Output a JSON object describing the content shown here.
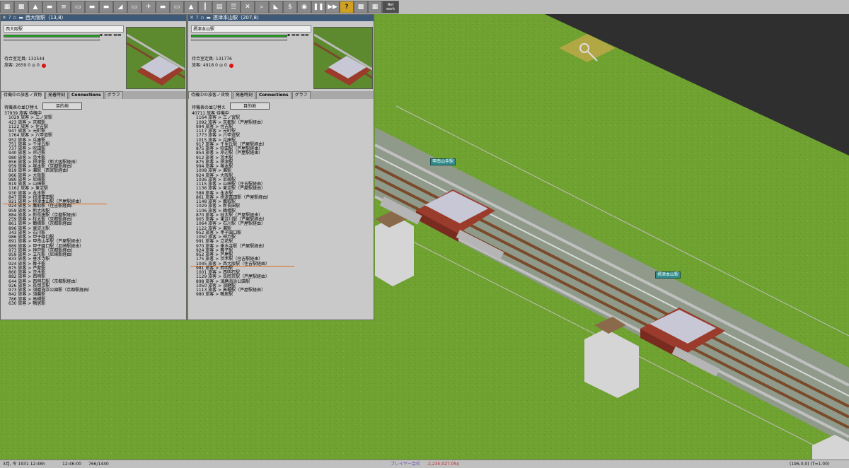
{
  "toolbar": {
    "buttons": [
      {
        "name": "save-icon",
        "glyph": "▦"
      },
      {
        "name": "map-icon",
        "glyph": "▩"
      },
      {
        "name": "landscape-icon",
        "glyph": "▲"
      },
      {
        "name": "road-icon",
        "glyph": "▬"
      },
      {
        "name": "rail-icon",
        "glyph": "≡"
      },
      {
        "name": "tram-icon",
        "glyph": "▭"
      },
      {
        "name": "monorail-icon",
        "glyph": "▬"
      },
      {
        "name": "maglev-icon",
        "glyph": "▬"
      },
      {
        "name": "ship-icon",
        "glyph": "◢"
      },
      {
        "name": "train-icon",
        "glyph": "▭"
      },
      {
        "name": "airport-icon",
        "glyph": "✈"
      },
      {
        "name": "bus-icon",
        "glyph": "▬"
      },
      {
        "name": "depot-icon",
        "glyph": "▭"
      },
      {
        "name": "industry-icon",
        "glyph": "▲"
      },
      {
        "name": "signal-icon",
        "glyph": "┃"
      },
      {
        "name": "stop-icon",
        "glyph": "▤"
      },
      {
        "name": "list-icon",
        "glyph": "☰"
      },
      {
        "name": "remove-icon",
        "glyph": "✕"
      },
      {
        "name": "inspect-icon",
        "glyph": "⌕"
      },
      {
        "name": "slope-icon",
        "glyph": "◣"
      },
      {
        "name": "money-icon",
        "glyph": "$"
      },
      {
        "name": "screenshot-icon",
        "glyph": "◉"
      },
      {
        "name": "pause-icon",
        "glyph": "❚❚"
      },
      {
        "name": "fast-forward-icon",
        "glyph": "▶▶"
      },
      {
        "name": "help-icon",
        "glyph": "?"
      },
      {
        "name": "minimap-icon",
        "glyph": "▩"
      },
      {
        "name": "grid-icon",
        "glyph": "▦"
      }
    ],
    "network_label": "Net work"
  },
  "windows": [
    {
      "title": "西大阪駅（13,8）",
      "name": "西大阪駅",
      "waiting": "待合室定員: 132544",
      "passengers": "旅客: 2659",
      "mail": "0",
      "goods": "0",
      "tabs": [
        "待機中の旅客ノ貨物",
        "発着時刻",
        "Connections",
        "グラフ"
      ],
      "sort_label": "待機表の並び替え",
      "sort_button": "目的地",
      "rows": [
        "37939 旅客 待機中",
        "1029 旅客 > 三ノ宮駅",
        "423 旅客 > 京都駅",
        "1122 旅客 > 住吉駅",
        "947 旅客 > 元町駅",
        "1764 旅客 > 六甲道駅",
        "952 旅客 > 兵庫駅",
        "751 旅客 > 千里丘駅",
        "737 旅客 > 吹田駅",
        "940 旅客 > 岸辺駅",
        "980 旅客 > 茨木駅",
        "856 旅客 > 摂津駅（新大阪駅経由）",
        "959 旅客 > 塚本駅（京都駅経由）",
        "819 旅客 > 灘駅（西宮駅経由）",
        "966 旅客 > 大阪駅",
        "980 旅客 > 尼崎駅",
        "819 旅客 > 山崎駅",
        "1162 旅客 > 東淀駅",
        "930 旅客 > 永本駅",
        "847 旅客 > 摂津富田駅",
        "921 旅客 > 摂津本山駅（芦屋駅経由）",
        "924 旅客 > 鷹取駅（住吉駅経由）",
        "959 旅客 > 新大阪駅",
        "884 旅客 > 新長田駅（京都駅経由）",
        "259 旅客 > 桂太駅（京都駅経由）",
        "861 旅客 > 鶴橋駅（京都駅経由）",
        "896 旅客 > 東淀川駅",
        "343 旅客 > 石川駅",
        "986 旅客 > 甲子園口駅",
        "891 旅客 > 甲南山手駅（芦屋駅経由）",
        "889 旅客 > 甲子園口駅（尼崎駅経由）",
        "973 旅客 > 神戸駅（京都駅経由）",
        "959 旅客 > 立花駅（尼崎駅経由）",
        "833 旅客 > 垂水寺駅",
        "924 旅客 > 舞子駅",
        "875 旅客 > 芦屋駅",
        "860 旅客 > 茨木駅",
        "882 旅客 > 西明駅",
        "644 旅客 > 西明石駅（京都駅経由）",
        "926 旅客 > 長岡京駅",
        "973 旅客 > 須磨海浜公園駅（京都駅経由）",
        "842 旅客 > 須磨駅",
        "786 旅客 > 高槻駅",
        "630 旅客 > 鴨居駅"
      ],
      "highlight_index": 20
    },
    {
      "title": "摂津本山駅（207,8）",
      "name": "摂津本山駅",
      "waiting": "待合室定員: 131776",
      "passengers": "旅客: 4918",
      "mail": "0",
      "goods": "0",
      "tabs": [
        "待機中の旅客ノ貨物",
        "発着時刻",
        "Connections",
        "グラフ"
      ],
      "sort_label": "待機表の並び替え",
      "sort_button": "目的地",
      "rows": [
        "40711 旅客 待機中",
        "1164 旅客 > 三ノ宮駅",
        "1092 旅客 > 京都駅（芦屋駅経由）",
        "994 旅客 > 住吉駅",
        "1117 旅客 > 元町駅",
        "1773 旅客 > 六甲道駅",
        "1015 旅客 > 兵庫駅",
        "917 旅客 > 千里丘駅（芦屋駅経由）",
        "875 旅客 > 吹田駅（芦屋駅経由）",
        "854 旅客 > 岸辺駅（芦屋駅経由）",
        "912 旅客 > 茨木駅",
        "875 旅客 > 摂津駅",
        "994 旅客 > 塚本駅",
        "1008 旅客 > 灘駅",
        "924 旅客 > 大阪駅",
        "1036 旅客 > 尼崎駅",
        "1115 旅客 > 山崎駅（住吉駅経由）",
        "1136 旅客 > 東淀駅（芦屋駅経由）",
        "588 旅客 > 永本駅",
        "861 旅客 > 摂津富田駅（芦屋駅経由）",
        "1148 旅客 > 鷹取駅",
        "1029 旅客 > 新長田駅",
        "1106 旅客 > 鶴橋駅",
        "870 旅客 > 桂太駅（芦屋駅経由）",
        "905 旅客 > 東淀川駅（芦屋駅経由）",
        "1064 旅客 > 石川駅（芦屋駅経由）",
        "1122 旅客 > 灘駅",
        "952 旅客 > 甲子園口駅",
        "1050 旅客 > 神戸駅",
        "991 旅客 > 立花駅",
        "970 旅客 > 垂水寺駅（芦屋駅経由）",
        "924 旅客 > 舞子駅",
        "952 旅客 > 芦屋駅",
        "175 旅客 > 茨木駅（住吉駅経由）",
        "1045 旅客 > 西大阪駅（住吉駅経由）",
        "981 旅客 > 西明駅",
        "1001 旅客 > 西明石駅",
        "1129 旅客 > 長岡京駅（芦屋駅経由）",
        "898 旅客 > 須磨海浜公園駅",
        "1050 旅客 > 須磨駅",
        "1113 旅客 > 高槻駅（芦屋駅経由）",
        "980 旅客 > 鴨居駅"
      ],
      "highlight_index": 34
    }
  ],
  "map": {
    "station_labels": [
      "甲南山手駅",
      "摂津本山駅"
    ]
  },
  "statusbar": {
    "date": "3月, 令 1931 12:46h",
    "time": "12:46:00",
    "ratio": "766/1440",
    "player": "プレイヤー会社",
    "money": "-2,235,027.05¢",
    "coords": "(196,0,0) (T=1.00)"
  },
  "colors": {
    "grass": "#6fa230",
    "void": "#2f2f2f",
    "window_bg": "#c9c9c9",
    "titlebar": "#3e5a78",
    "highlight": "#e06a1c",
    "money_negative": "#c02020"
  }
}
